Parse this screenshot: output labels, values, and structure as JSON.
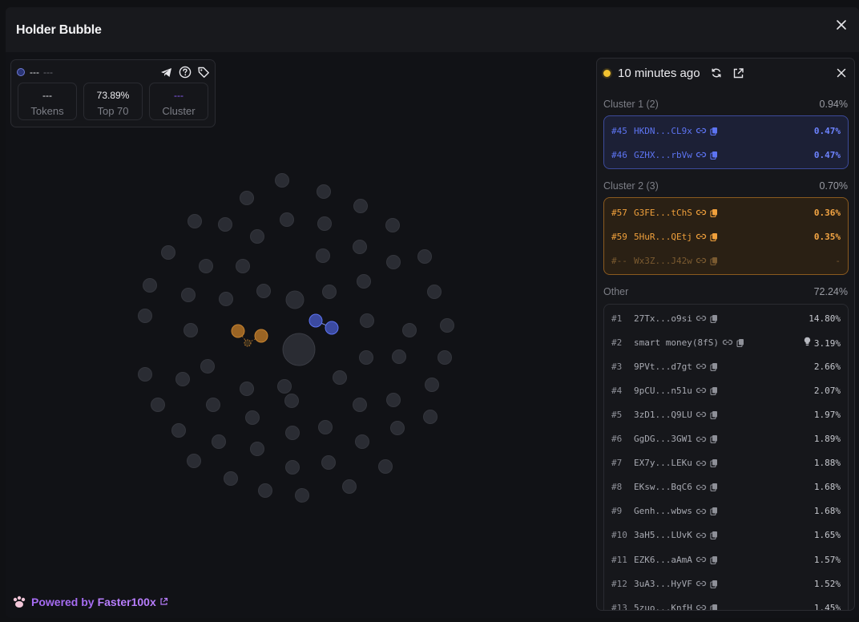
{
  "modal": {
    "title": "Holder Bubble"
  },
  "token": {
    "name": "---",
    "sub": "---"
  },
  "stats": [
    {
      "value": "---",
      "label": "Tokens"
    },
    {
      "value": "73.89%",
      "label": "Top 70"
    },
    {
      "value": "---",
      "label": "Cluster"
    }
  ],
  "footer": {
    "prefix": "Powered by",
    "brand": "Faster100x"
  },
  "panel": {
    "time": "10 minutes ago",
    "cluster1": {
      "title": "Cluster 1 (2)",
      "pct": "0.94%",
      "rows": [
        {
          "rank": "#45",
          "addr": "HKDN...CL9x",
          "pct": "0.47%"
        },
        {
          "rank": "#46",
          "addr": "GZHX...rbVw",
          "pct": "0.47%"
        }
      ]
    },
    "cluster2": {
      "title": "Cluster 2 (3)",
      "pct": "0.70%",
      "rows": [
        {
          "rank": "#57",
          "addr": "G3FE...tChS",
          "pct": "0.36%"
        },
        {
          "rank": "#59",
          "addr": "5HuR...QEtj",
          "pct": "0.35%"
        },
        {
          "rank": "#--",
          "addr": "Wx3Z...J42w",
          "pct": "-"
        }
      ]
    },
    "other": {
      "title": "Other",
      "pct": "72.24%",
      "rows": [
        {
          "rank": "#1",
          "addr": "27Tx...o9si",
          "pct": "14.80%"
        },
        {
          "rank": "#2",
          "addr": "smart money(8fS)",
          "pct": "3.19%"
        },
        {
          "rank": "#3",
          "addr": "9PVt...d7gt",
          "pct": "2.66%"
        },
        {
          "rank": "#4",
          "addr": "9pCU...n51u",
          "pct": "2.07%"
        },
        {
          "rank": "#5",
          "addr": "3zD1...Q9LU",
          "pct": "1.97%"
        },
        {
          "rank": "#6",
          "addr": "GgDG...3GW1",
          "pct": "1.89%"
        },
        {
          "rank": "#7",
          "addr": "EX7y...LEKu",
          "pct": "1.88%"
        },
        {
          "rank": "#8",
          "addr": "EKsw...BqC6",
          "pct": "1.68%"
        },
        {
          "rank": "#9",
          "addr": "Genh...wbws",
          "pct": "1.68%"
        },
        {
          "rank": "#10",
          "addr": "3aH5...LUvK",
          "pct": "1.65%"
        },
        {
          "rank": "#11",
          "addr": "EZK6...aAmA",
          "pct": "1.57%"
        },
        {
          "rank": "#12",
          "addr": "3uA3...HyVF",
          "pct": "1.52%"
        },
        {
          "rank": "#13",
          "addr": "5zuo...KnfH",
          "pct": "1.45%"
        }
      ]
    }
  },
  "colors": {
    "cluster1": "#5d74f2",
    "cluster2": "#f0a03c",
    "bubble": "#2a2c33",
    "accent": "#a66cf2"
  }
}
